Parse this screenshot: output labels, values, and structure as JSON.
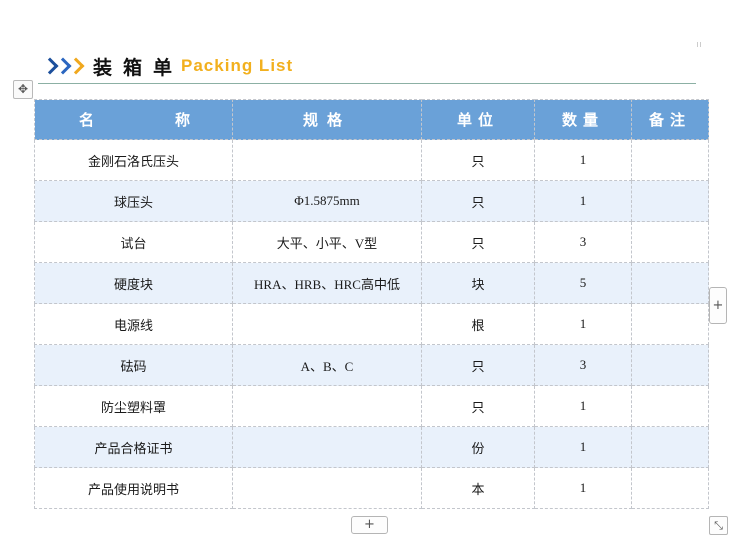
{
  "title": {
    "cn": "装箱单",
    "en": "Packing List"
  },
  "table": {
    "headers": {
      "name_1": "名",
      "name_2": "称",
      "spec": "规格",
      "unit": "单位",
      "qty": "数量",
      "note": "备注"
    },
    "rows": [
      {
        "name": "金刚石洛氏压头",
        "spec": "",
        "unit": "只",
        "qty": "1",
        "note": ""
      },
      {
        "name": "球压头",
        "spec": "Φ1.5875mm",
        "unit": "只",
        "qty": "1",
        "note": ""
      },
      {
        "name": "试台",
        "spec": "大平、小平、V型",
        "unit": "只",
        "qty": "3",
        "note": ""
      },
      {
        "name": "硬度块",
        "spec": "HRA、HRB、HRC高中低",
        "unit": "块",
        "qty": "5",
        "note": ""
      },
      {
        "name": "电源线",
        "spec": "",
        "unit": "根",
        "qty": "1",
        "note": ""
      },
      {
        "name": "砝码",
        "spec": "A、B、C",
        "unit": "只",
        "qty": "3",
        "note": ""
      },
      {
        "name": "防尘塑料罩",
        "spec": "",
        "unit": "只",
        "qty": "1",
        "note": ""
      },
      {
        "name": "产品合格证书",
        "spec": "",
        "unit": "份",
        "qty": "1",
        "note": ""
      },
      {
        "name": "产品使用说明书",
        "spec": "",
        "unit": "本",
        "qty": "1",
        "note": ""
      }
    ]
  },
  "controls": {
    "move_icon": "move-arrows-icon",
    "add_column_icon": "plus-icon",
    "add_row_icon": "plus-icon",
    "resize_icon": "resize-diagonal-icon"
  },
  "colors": {
    "header_bg": "#6aa1d8",
    "alt_row_bg": "#e9f1fb",
    "title_en": "#f2b01e",
    "chevron_blue": "#1c4f9c",
    "chevron_yellow": "#f0a81e"
  }
}
